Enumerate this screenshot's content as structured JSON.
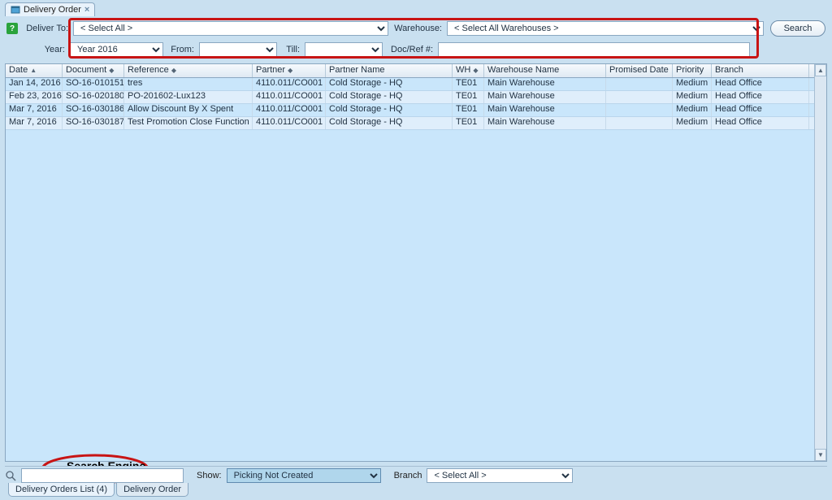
{
  "tab": {
    "title": "Delivery Order",
    "close": "×"
  },
  "filters": {
    "deliverToLabel": "Deliver To:",
    "deliverToValue": "< Select All >",
    "warehouseLabel": "Warehouse:",
    "warehouseValue": "< Select All Warehouses >",
    "searchBtn": "Search",
    "yearLabel": "Year:",
    "yearValue": "Year 2016",
    "fromLabel": "From:",
    "fromValue": "",
    "tillLabel": "Till:",
    "tillValue": "",
    "docRefLabel": "Doc/Ref #:",
    "docRefValue": ""
  },
  "grid": {
    "headers": {
      "date": "Date",
      "document": "Document",
      "reference": "Reference",
      "partner": "Partner",
      "partnerName": "Partner Name",
      "wh": "WH",
      "warehouseName": "Warehouse Name",
      "promisedDate": "Promised Date",
      "priority": "Priority",
      "branch": "Branch"
    },
    "rows": [
      {
        "date": "Jan 14, 2016",
        "doc": "SO-16-010151",
        "ref": "tres",
        "partner": "4110.011/CO001",
        "pname": "Cold Storage - HQ",
        "wh": "TE01",
        "whn": "Main Warehouse",
        "prom": "",
        "prio": "Medium",
        "brn": "Head Office"
      },
      {
        "date": "Feb 23, 2016",
        "doc": "SO-16-020180",
        "ref": "PO-201602-Lux123",
        "partner": "4110.011/CO001",
        "pname": "Cold Storage - HQ",
        "wh": "TE01",
        "whn": "Main Warehouse",
        "prom": "",
        "prio": "Medium",
        "brn": "Head Office"
      },
      {
        "date": "Mar 7, 2016",
        "doc": "SO-16-030186",
        "ref": "Allow Discount By X Spent",
        "partner": "4110.011/CO001",
        "pname": "Cold Storage - HQ",
        "wh": "TE01",
        "whn": "Main Warehouse",
        "prom": "",
        "prio": "Medium",
        "brn": "Head Office"
      },
      {
        "date": "Mar 7, 2016",
        "doc": "SO-16-030187",
        "ref": "Test Promotion Close Function",
        "partner": "4110.011/CO001",
        "pname": "Cold Storage - HQ",
        "wh": "TE01",
        "whn": "Main Warehouse",
        "prom": "",
        "prio": "Medium",
        "brn": "Head Office"
      }
    ]
  },
  "annotation": {
    "label": "Search Engine"
  },
  "status": {
    "searchValue": "",
    "showLabel": "Show:",
    "showValue": "Picking Not Created",
    "branchLabel": "Branch",
    "branchValue": "< Select All >"
  },
  "bottomTabs": {
    "listTab": "Delivery Orders List (4)",
    "detailTab": "Delivery Order"
  }
}
